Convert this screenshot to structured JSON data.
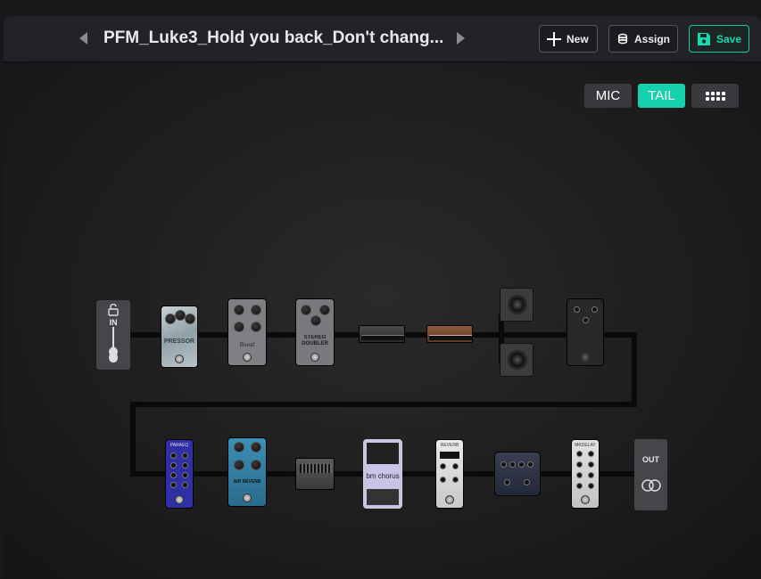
{
  "header": {
    "preset_title": "PFM_Luke3_Hold you back_Don't chang...",
    "new_label": "New",
    "assign_label": "Assign",
    "save_label": "Save"
  },
  "view_toggle": {
    "mic_label": "MIC",
    "tail_label": "TAIL",
    "active": "TAIL"
  },
  "signal_chain": {
    "input_label": "IN",
    "output_label": "OUT",
    "blocks": [
      {
        "name": "pressor-compressor",
        "label": "PRESSOR"
      },
      {
        "name": "boost-pedal",
        "label": "Boost"
      },
      {
        "name": "stereo-doubler",
        "label": "STEREO DOUBLER"
      },
      {
        "name": "amp-1"
      },
      {
        "name": "amp-2"
      },
      {
        "name": "cab-1"
      },
      {
        "name": "cab-2"
      },
      {
        "name": "dark-pedal"
      },
      {
        "name": "parametric-eq",
        "label": "PARAEQ"
      },
      {
        "name": "air-reverb",
        "label": "AIR REVERB"
      },
      {
        "name": "graphic-eq"
      },
      {
        "name": "bm-chorus",
        "label": "bm chorus"
      },
      {
        "name": "reverb-pedal",
        "label": "REVERB"
      },
      {
        "name": "multi-effect-unit"
      },
      {
        "name": "delay-pedal",
        "label": "MKDELAY"
      }
    ]
  },
  "colors": {
    "accent": "#17d1ad",
    "background": "#18181b"
  }
}
